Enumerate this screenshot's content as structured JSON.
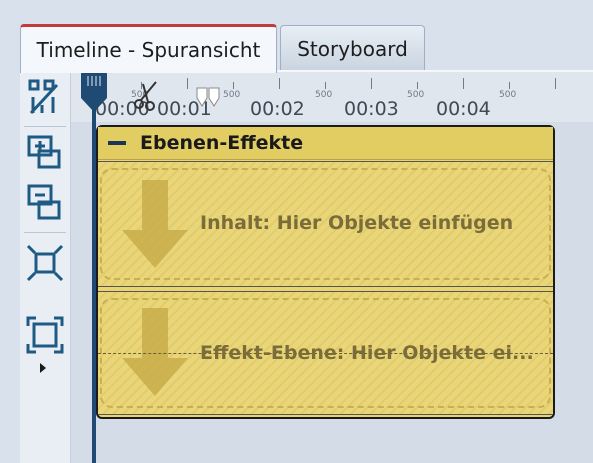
{
  "tabs": [
    {
      "label": "Timeline - Spuransicht",
      "active": true
    },
    {
      "label": "Storyboard",
      "active": false
    }
  ],
  "toolbar": {
    "tools": [
      {
        "name": "split-percent-icon"
      },
      {
        "name": "add-track-icon"
      },
      {
        "name": "remove-track-icon"
      },
      {
        "name": "shrink-view-icon"
      },
      {
        "name": "expand-view-icon"
      }
    ]
  },
  "ruler": {
    "time_labels": [
      "00:00",
      "00:01",
      "00:02",
      "00:03",
      "00:04"
    ],
    "minor_label": "500"
  },
  "group": {
    "title": "Ebenen-Effekte",
    "content_slot": "Inhalt: Hier Objekte einfügen",
    "effect_slot": "Effekt-Ebene: Hier Objekte ei..."
  },
  "colors": {
    "accent_tab": "#c43a3a",
    "playhead": "#1f4a73",
    "group_bg": "#e9d56d",
    "icon_blue": "#1d5a84"
  }
}
